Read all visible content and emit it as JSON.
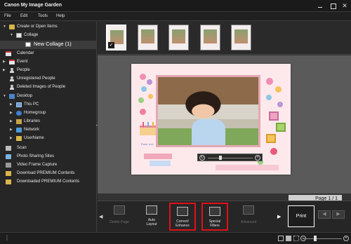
{
  "window": {
    "title": "Canon My Image Garden",
    "close_glyph": "✕"
  },
  "menu": {
    "items": [
      "File",
      "Edit",
      "Tools",
      "Help"
    ]
  },
  "tree": {
    "create_or_open": "Create or Open Items",
    "collage": "Collage",
    "new_collage": "New Collage (1)",
    "calendar": "Calendar",
    "event": "Event",
    "people": "People",
    "unregistered_people": "Unregistered People",
    "deleted_images": "Deleted Images of People",
    "desktop": "Desktop",
    "this_pc": "This PC",
    "homegroup": "Homegroup",
    "libraries": "Libraries",
    "network": "Network",
    "username": "UserName",
    "scan": "Scan",
    "photo_sharing": "Photo Sharing Sites",
    "video_capture": "Video Frame Capture",
    "download_premium": "Download PREMIUM Contents",
    "downloaded_premium": "Downloaded PREMIUM Contents"
  },
  "thumbnails": {
    "count": 5,
    "selected_index": 0,
    "check_glyph": "✓"
  },
  "canvas": {
    "enter_text": "Enter text",
    "page_label": "Page 1 / 1"
  },
  "toolbar": {
    "delete_page": "Delete Page",
    "auto_layout_1": "Auto",
    "auto_layout_2": "Layout",
    "correct_enhance_1": "Correct/",
    "correct_enhance_2": "Enhance",
    "special_filters_1": "Special",
    "special_filters_2": "Filters",
    "advanced": "Advanced",
    "print": "Print",
    "left_arrow": "◀",
    "right_arrow": "▶"
  },
  "colors": {
    "highlight": "#e0101a",
    "page_bg": "#fde9ec",
    "frame": "#e5a8b3"
  }
}
